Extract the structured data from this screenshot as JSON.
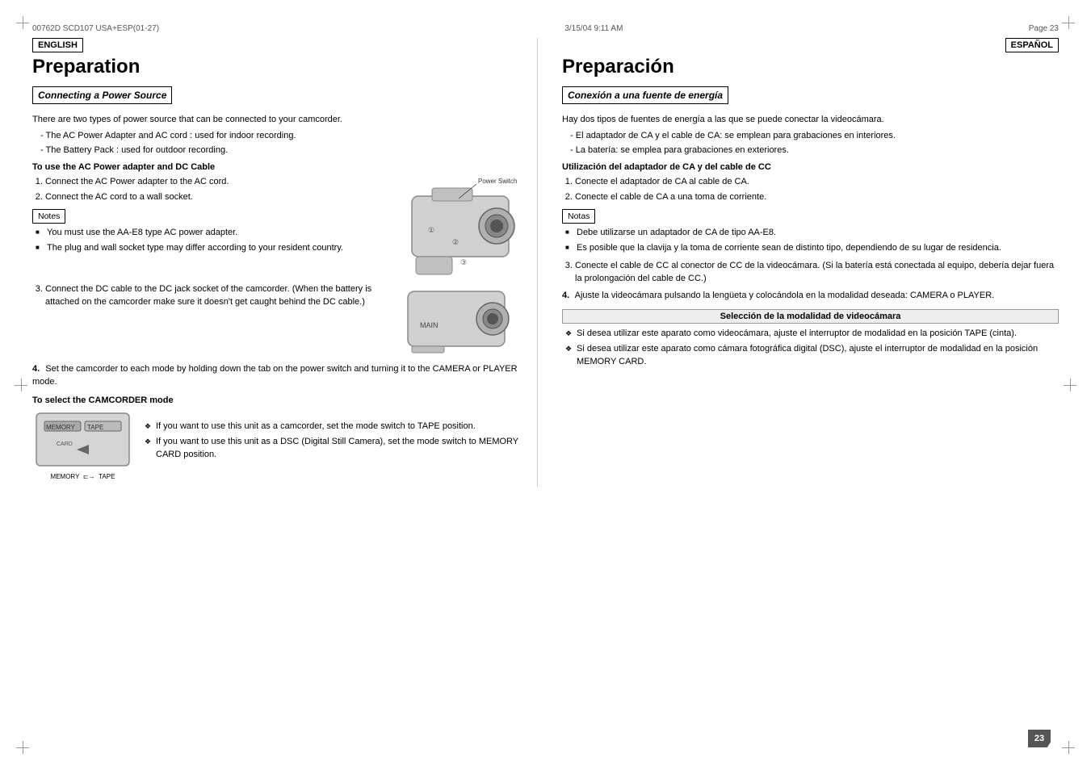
{
  "header": {
    "doc_id": "00762D SCD107 USA+ESP(01-27)",
    "date": "3/15/04 9:11 AM",
    "page": "Page 23"
  },
  "english": {
    "lang_label": "ENGLISH",
    "title": "Preparation",
    "section1": {
      "heading": "Connecting a Power Source",
      "intro": "There are two types of power source that can be connected to your camcorder.",
      "list": [
        "The AC Power Adapter and AC cord : used for indoor recording.",
        "The Battery Pack : used for outdoor recording."
      ]
    },
    "subsection1": {
      "heading": "To use the AC Power adapter and DC Cable",
      "steps": [
        "Connect the AC Power adapter to the AC cord.",
        "Connect the AC cord to a wall socket."
      ],
      "notes_label": "Notes",
      "notes": [
        "You must use the AA-E8 type AC power adapter.",
        "The plug and wall socket type may differ according to your resident country."
      ],
      "step3": "Connect the DC cable to the DC jack socket of the camcorder. (When the battery is attached on the camcorder make sure it doesn't get caught behind the DC cable.)",
      "step4": "Set the camcorder to each mode by holding down the tab on the power switch and turning it to the CAMERA or PLAYER mode.",
      "power_switch_label": "Power Switch"
    },
    "subsection2": {
      "heading": "To select the CAMCORDER mode",
      "items": [
        "If you want to use this unit as a camcorder, set the mode switch to TAPE position.",
        "If you want to use this unit as a DSC (Digital Still Camera), set the mode switch to MEMORY CARD position."
      ]
    }
  },
  "spanish": {
    "lang_label": "ESPAÑOL",
    "title": "Preparación",
    "section1": {
      "heading": "Conexión a una fuente de energía",
      "intro": "Hay dos tipos de fuentes de energía a las que se puede conectar la videocámara.",
      "list": [
        "El adaptador de CA y el cable de CA: se emplean para grabaciones en interiores.",
        "La batería: se emplea para grabaciones en exteriores."
      ]
    },
    "subsection1": {
      "heading": "Utilización del adaptador de CA y del cable de CC",
      "steps": [
        "Conecte el adaptador de CA al cable de CA.",
        "Conecte el cable de CA a una toma de corriente."
      ],
      "notes_label": "Notas",
      "notes": [
        "Debe utilizarse un adaptador de CA de tipo AA-E8.",
        "Es posible que la clavija y la toma de corriente sean de distinto tipo, dependiendo de su lugar de residencia."
      ],
      "step3": "Conecte el cable de CC al conector de CC de la videocámara. (Si la batería está conectada al equipo, debería dejar fuera la prolongación del cable de CC.)",
      "step4": "Ajuste la videocámara pulsando la lengüeta y colocándola en la modalidad deseada: CAMERA o PLAYER."
    },
    "subsection2": {
      "heading": "Selección de la modalidad de videocámara",
      "items": [
        "Si desea utilizar este aparato como videocámara, ajuste el interruptor de modalidad en la posición TAPE (cinta).",
        "Si desea utilizar este aparato como cámara fotográfica digital (DSC), ajuste el interruptor de modalidad en la posición MEMORY CARD."
      ]
    }
  },
  "page_number": "23"
}
